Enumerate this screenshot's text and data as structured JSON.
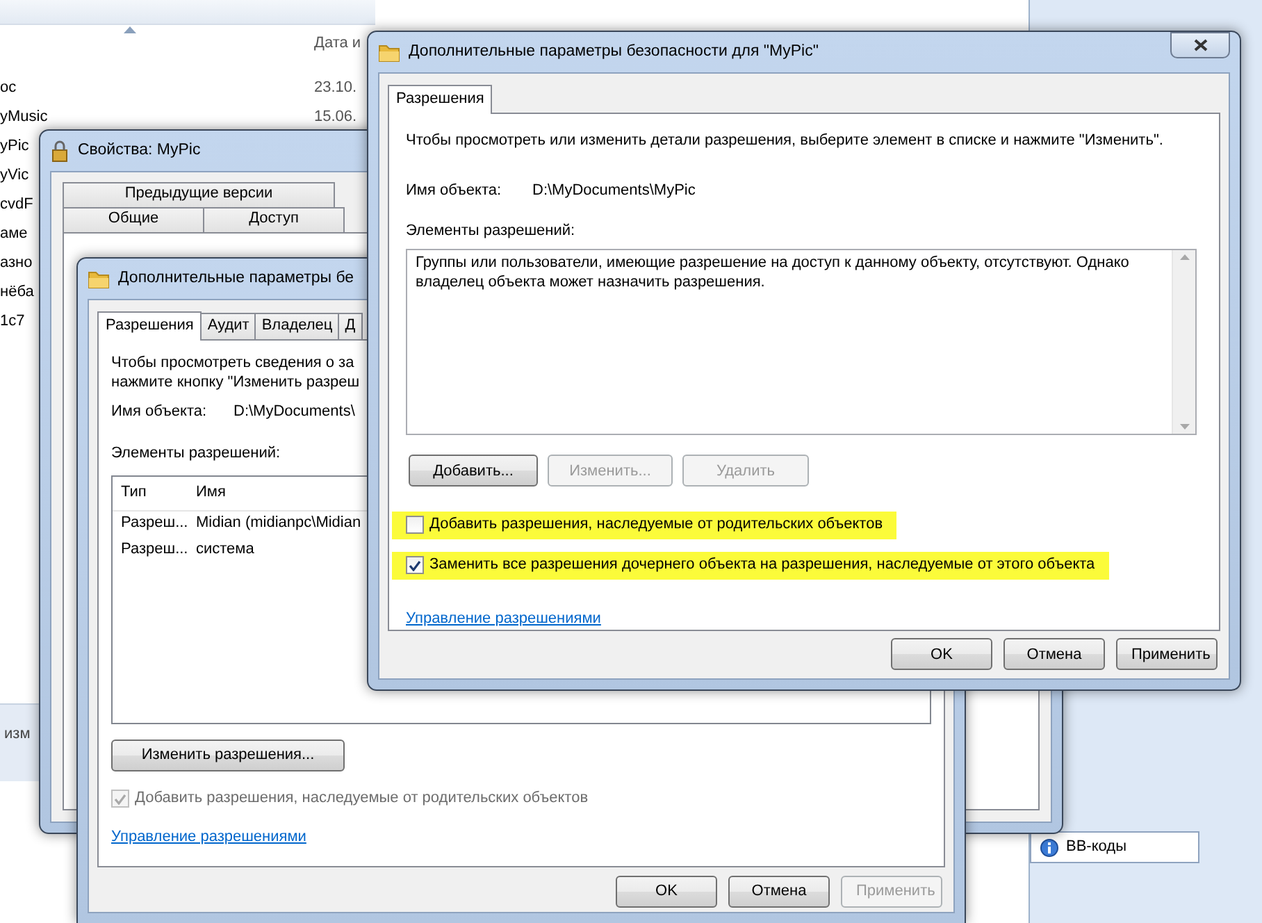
{
  "explorer": {
    "column_header": "Дата и",
    "files": [
      {
        "name": "ос",
        "date": "23.10."
      },
      {
        "name": "yMusic",
        "date": "15.06."
      },
      {
        "name": "yPic"
      },
      {
        "name": "yVic"
      },
      {
        "name": "cvdF"
      },
      {
        "name": "аме"
      },
      {
        "name": "азно"
      },
      {
        "name": "нёба"
      },
      {
        "name": "1с7"
      }
    ],
    "status_text": "изм"
  },
  "editor_panel": {
    "bb_button": "BB-коды"
  },
  "properties_window": {
    "title": "Свойства: MyPic",
    "tab_rows": [
      [
        {
          "label": "Предыдущие версии",
          "selected": false
        }
      ],
      [
        {
          "label": "Общие",
          "selected": false
        },
        {
          "label": "Доступ",
          "selected": false
        }
      ]
    ]
  },
  "advanced_window_back": {
    "title": "Дополнительные параметры бе",
    "tabs": [
      {
        "label": "Разрешения",
        "selected": true
      },
      {
        "label": "Аудит",
        "selected": false
      },
      {
        "label": "Владелец",
        "selected": false
      },
      {
        "label": "Д",
        "selected": false
      }
    ],
    "intro_lines": [
      "Чтобы просмотреть сведения о за",
      "нажмите кнопку \"Изменить разреш"
    ],
    "object_label": "Имя объекта:",
    "object_value": "D:\\MyDocuments\\",
    "list_label": "Элементы разрешений:",
    "table": {
      "columns": [
        "Тип",
        "Имя"
      ],
      "rows": [
        [
          "Разреш...",
          "Midian (midianpc\\Midian"
        ],
        [
          "Разреш...",
          "система"
        ]
      ]
    },
    "change_button": "Изменить разрешения...",
    "checkbox": {
      "label": "Добавить разрешения, наследуемые от родительских объектов",
      "checked": true,
      "disabled": true
    },
    "link": "Управление разрешениями",
    "buttons": [
      {
        "label": "OK",
        "disabled": false
      },
      {
        "label": "Отмена",
        "disabled": false
      },
      {
        "label": "Применить",
        "disabled": true
      }
    ]
  },
  "advanced_window_front": {
    "title": "Дополнительные параметры безопасности  для \"MyPic\"",
    "tabs": [
      {
        "label": "Разрешения",
        "selected": true
      }
    ],
    "intro": "Чтобы просмотреть или изменить детали разрешения, выберите элемент в списке и нажмите \"Изменить\".",
    "object_label": "Имя объекта:",
    "object_value": "D:\\MyDocuments\\MyPic",
    "list_label": "Элементы разрешений:",
    "list_message": "Группы или пользователи, имеющие разрешение на доступ к данному объекту, отсутствуют. Однако владелец объекта может назначить разрешения.",
    "action_buttons": [
      {
        "label": "Добавить...",
        "disabled": false
      },
      {
        "label": "Изменить...",
        "disabled": true
      },
      {
        "label": "Удалить",
        "disabled": true
      }
    ],
    "checkboxes": [
      {
        "label": "Добавить разрешения, наследуемые от родительских объектов",
        "checked": false,
        "highlighted": true
      },
      {
        "label": "Заменить все разрешения дочернего объекта на разрешения, наследуемые от этого объекта",
        "checked": true,
        "highlighted": true
      }
    ],
    "link": "Управление разрешениями",
    "buttons": [
      {
        "label": "OK",
        "disabled": false
      },
      {
        "label": "Отмена",
        "disabled": false
      },
      {
        "label": "Применить",
        "disabled": false
      }
    ]
  }
}
